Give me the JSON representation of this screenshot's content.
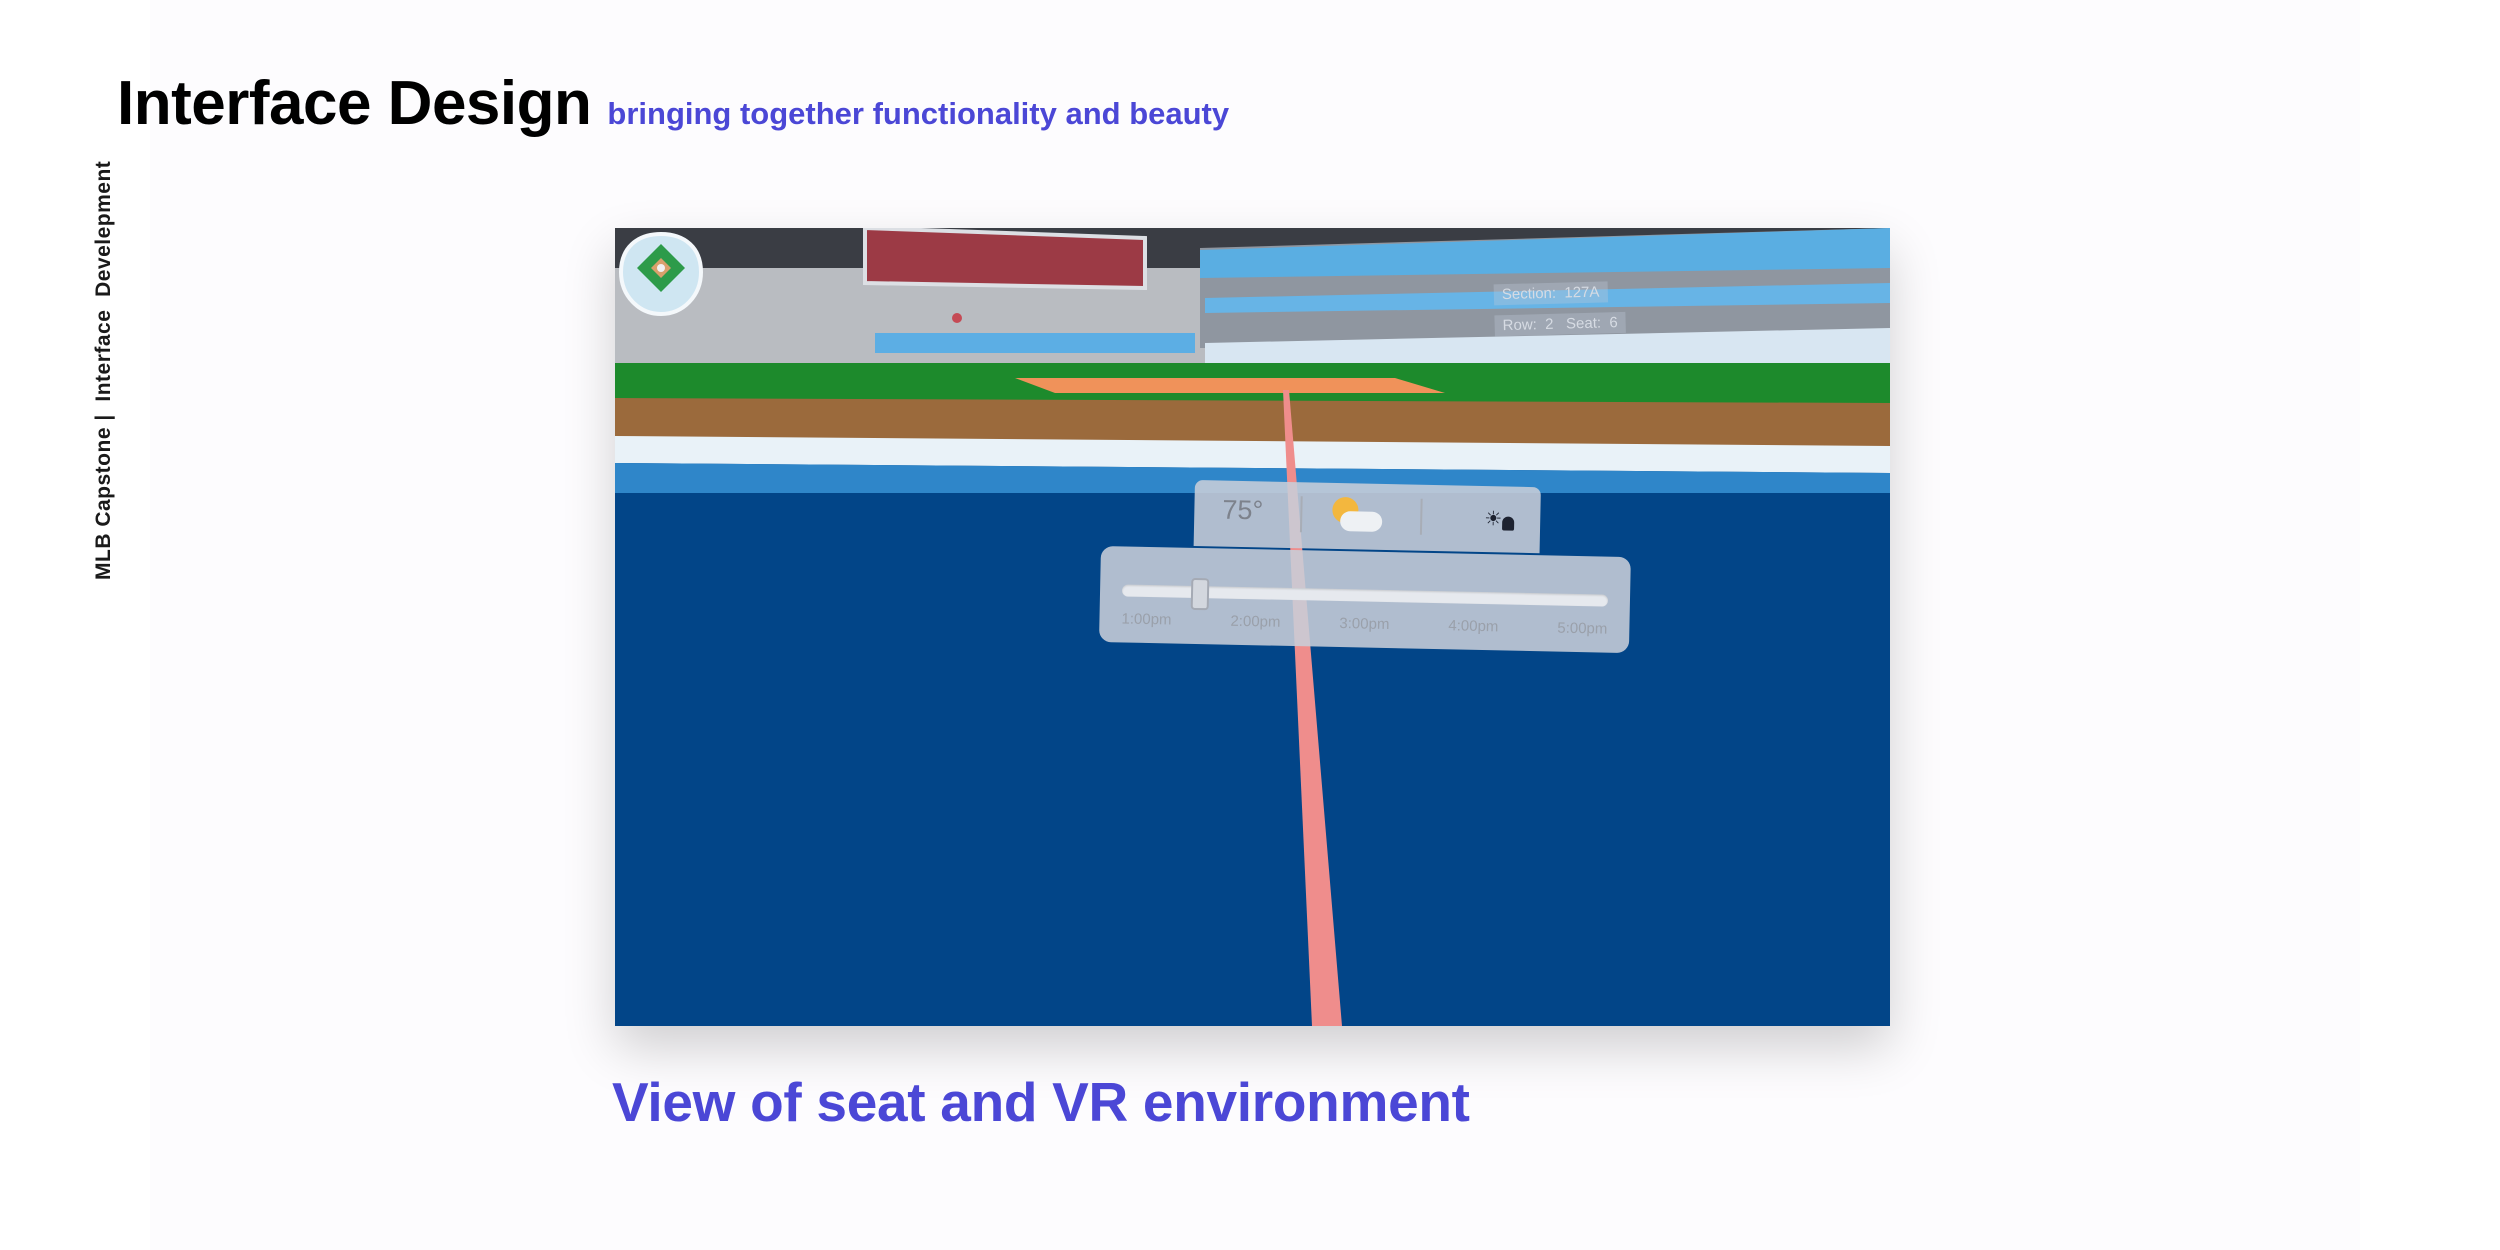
{
  "side_label": "MLB Capstone |  Interface  Develepment",
  "header": {
    "title": "Interface Design",
    "subtitle": "bringing together functionality and beauty"
  },
  "vr_view": {
    "seat_info": {
      "section_label": "Section:",
      "section_value": "127A",
      "row_label": "Row:",
      "row_value": "2",
      "seat_label": "Seat:",
      "seat_value": "6"
    },
    "weather": {
      "temperature": "75°",
      "condition_icon": "partly-sunny-icon",
      "lighting_icon": "sun-person-icon"
    },
    "time_slider": {
      "ticks": [
        "1:00pm",
        "2:00pm",
        "3:00pm",
        "4:00pm",
        "5:00pm"
      ],
      "position": 0.16
    },
    "stadium_map_icon": "stadium-map-icon"
  },
  "caption": "View of seat and VR environment"
}
